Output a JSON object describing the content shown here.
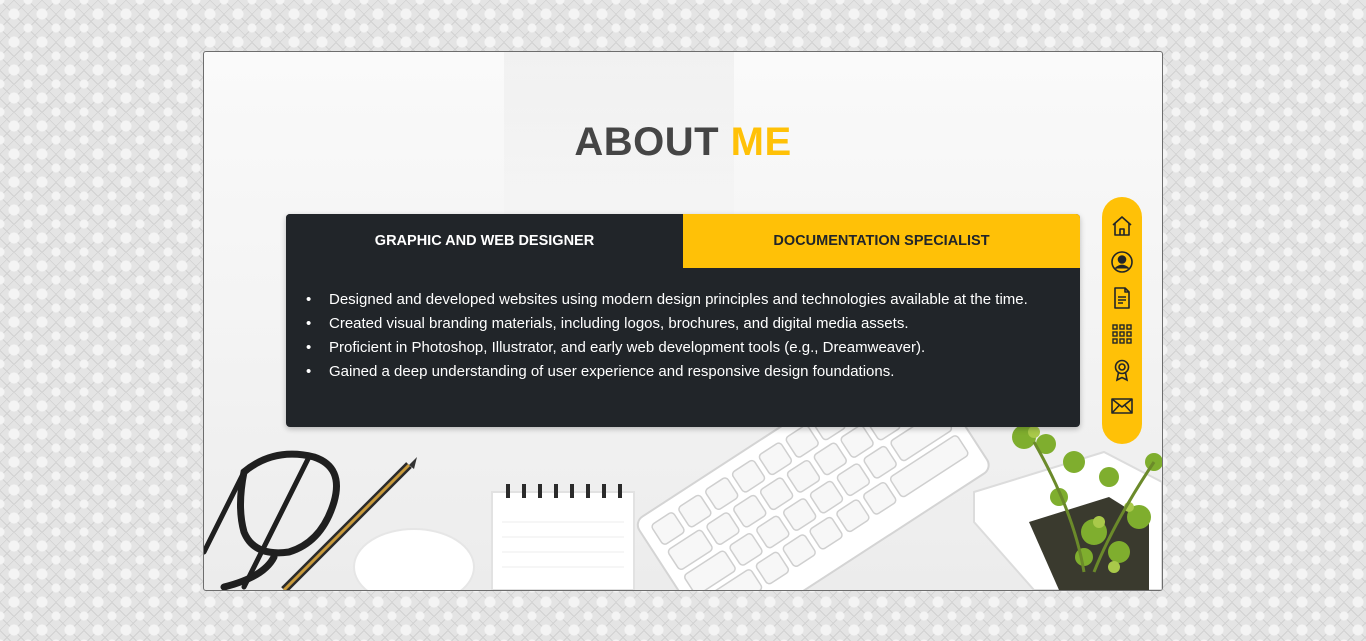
{
  "title": {
    "main": "ABOUT",
    "accent": "ME"
  },
  "tabs": [
    {
      "label": "GRAPHIC AND WEB DESIGNER",
      "active": true
    },
    {
      "label": "DOCUMENTATION SPECIALIST",
      "active": false
    }
  ],
  "bullets": [
    "Designed and developed websites using modern design principles and technologies available at the time.",
    "Created visual branding materials, including logos, brochures, and digital media assets.",
    "Proficient in Photoshop, Illustrator, and early web development tools (e.g., Dreamweaver).",
    "Gained a deep understanding of user experience and responsive design foundations."
  ],
  "bullet_char": "•",
  "side_nav": [
    "home-icon",
    "user-icon",
    "document-icon",
    "grid-icon",
    "award-icon",
    "mail-icon"
  ],
  "colors": {
    "accent": "#ffc107",
    "card": "#212529",
    "title": "#454545"
  }
}
